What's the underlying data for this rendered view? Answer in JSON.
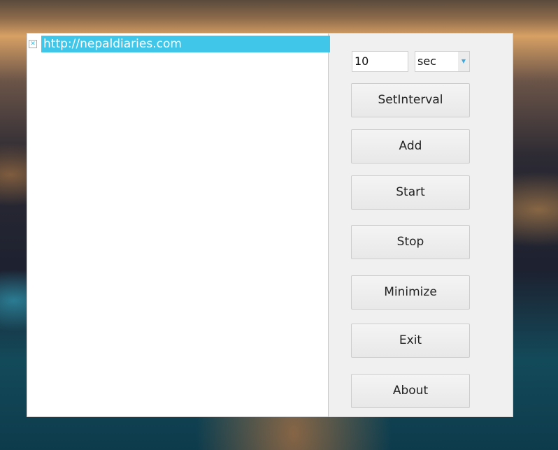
{
  "list": {
    "items": [
      {
        "label": "http://nepaldiaries.com",
        "checked": true,
        "selected": true
      }
    ]
  },
  "interval": {
    "value": "10",
    "unit": "sec"
  },
  "buttons": {
    "set_interval": "SetInterval",
    "add": "Add",
    "start": "Start",
    "stop": "Stop",
    "minimize": "Minimize",
    "exit": "Exit",
    "about": "About"
  }
}
